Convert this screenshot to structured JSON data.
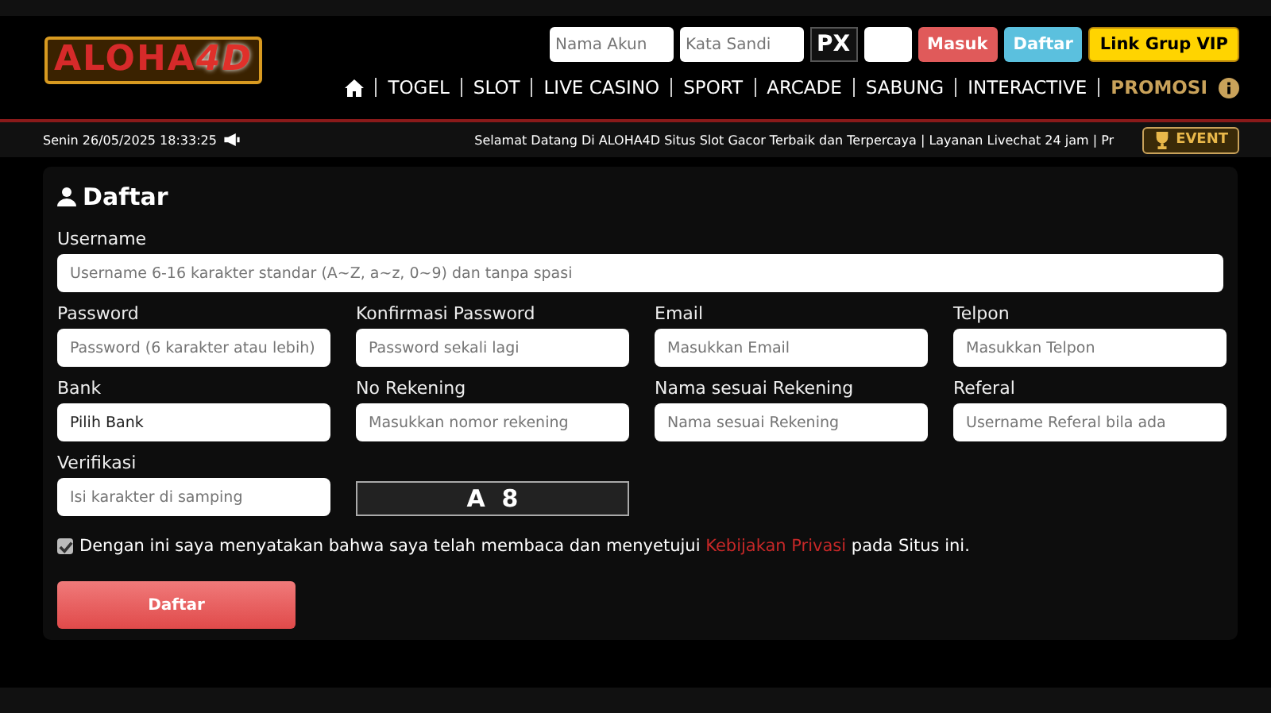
{
  "logo": {
    "main": "ALOHA",
    "accent": "4D"
  },
  "login": {
    "username_placeholder": "Nama Akun",
    "password_placeholder": "Kata Sandi",
    "captcha": "PX",
    "buttons": [
      {
        "label": "Masuk",
        "kind": "login"
      },
      {
        "label": "Daftar",
        "kind": "register"
      },
      {
        "label": "Link Grup VIP",
        "kind": "vip"
      }
    ]
  },
  "nav": [
    {
      "label": "TOGEL",
      "kind": "normal"
    },
    {
      "label": "SLOT",
      "kind": "normal"
    },
    {
      "label": "LIVE CASINO",
      "kind": "normal"
    },
    {
      "label": "SPORT",
      "kind": "normal"
    },
    {
      "label": "ARCADE",
      "kind": "normal"
    },
    {
      "label": "SABUNG",
      "kind": "normal"
    },
    {
      "label": "INTERACTIVE",
      "kind": "normal"
    },
    {
      "label": "PROMOSI",
      "kind": "promo"
    }
  ],
  "ticker": {
    "datetime": "Senin 26/05/2025 18:33:25",
    "message": "Selamat Datang Di ALOHA4D Situs Slot Gacor Terbaik dan Terpercaya | Layanan Livechat 24 jam | Pr",
    "event": "EVENT"
  },
  "form": {
    "title": "Daftar",
    "username": {
      "label": "Username",
      "placeholder": "Username 6-16 karakter standar (A~Z, a~z, 0~9) dan tanpa spasi"
    },
    "fields": [
      {
        "label": "Password",
        "placeholder": "Password (6 karakter atau lebih)",
        "kind": "input"
      },
      {
        "label": "Konfirmasi Password",
        "placeholder": "Password sekali lagi",
        "kind": "input"
      },
      {
        "label": "Email",
        "placeholder": "Masukkan Email",
        "kind": "input"
      },
      {
        "label": "Telpon",
        "placeholder": "Masukkan Telpon",
        "kind": "input"
      },
      {
        "label": "Bank",
        "value": "Pilih Bank",
        "kind": "select"
      },
      {
        "label": "No Rekening",
        "placeholder": "Masukkan nomor rekening",
        "kind": "input"
      },
      {
        "label": "Nama sesuai Rekening",
        "placeholder": "Nama sesuai Rekening",
        "kind": "input"
      },
      {
        "label": "Referal",
        "placeholder": "Username Referal bila ada",
        "kind": "input"
      }
    ],
    "verification": {
      "label": "Verifikasi",
      "placeholder": "Isi karakter di samping",
      "captcha": "A  8"
    },
    "agreement": {
      "checked": true,
      "before": "Dengan ini saya menyatakan bahwa saya telah membaca dan menyetujui",
      "link": "Kebijakan Privasi",
      "after": "pada Situs ini."
    },
    "submit": "Daftar"
  }
}
